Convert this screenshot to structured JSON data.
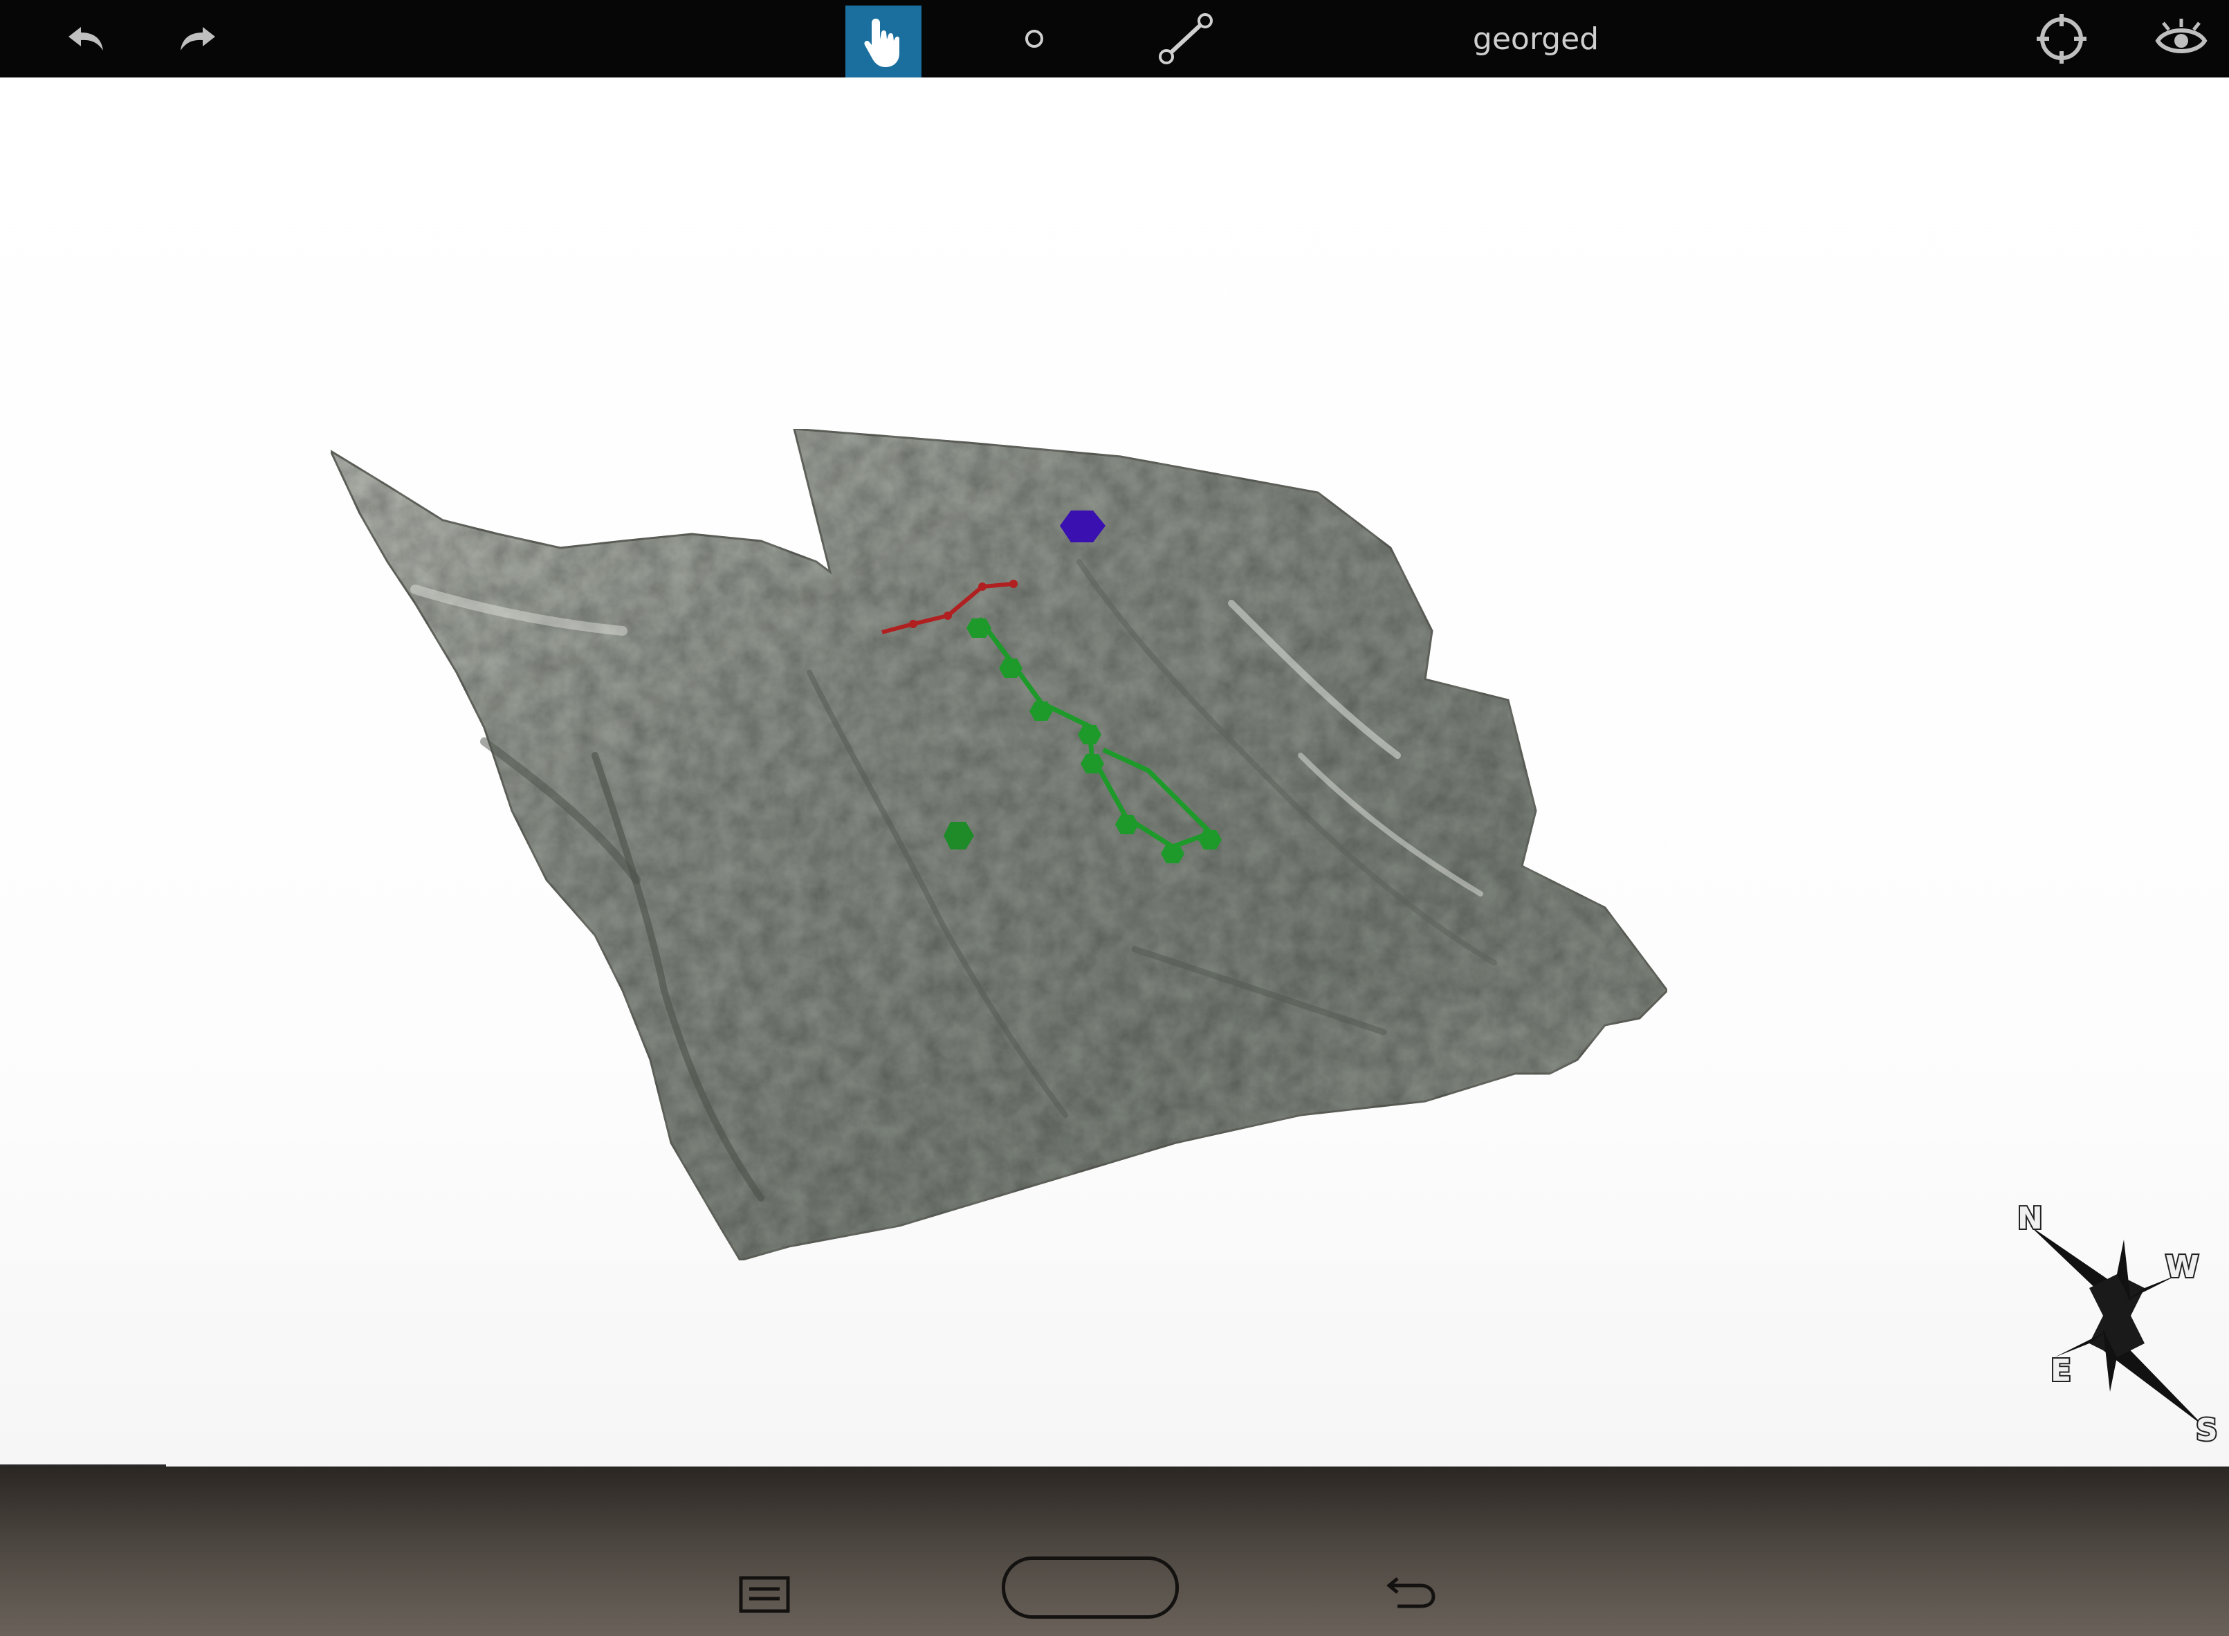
{
  "toolbar": {
    "user_name": "georged",
    "active_tool": "pan",
    "icons": [
      "undo-icon",
      "redo-icon",
      "hand-pointer-icon",
      "point-icon",
      "line-measure-icon",
      "crosshair-target-icon",
      "eye-icon"
    ],
    "colors": {
      "background": "#060606",
      "active_tool": "#1b6f9e",
      "icon": "#bfbfbf"
    }
  },
  "viewport": {
    "background": "#ffffff",
    "surface_color": "#8a9088",
    "annotations": {
      "purple_polygon": {
        "color": "#3a10b0"
      },
      "red_line": {
        "color": "#b02020"
      },
      "green_path": {
        "color": "#1e9a2a"
      },
      "green_point": {
        "color": "#1e8a28"
      }
    }
  },
  "compass": {
    "north": "N",
    "west": "W",
    "east": "E",
    "south": "S"
  },
  "device_buttons": [
    "menu-button-icon",
    "home-button",
    "back-button-icon"
  ]
}
